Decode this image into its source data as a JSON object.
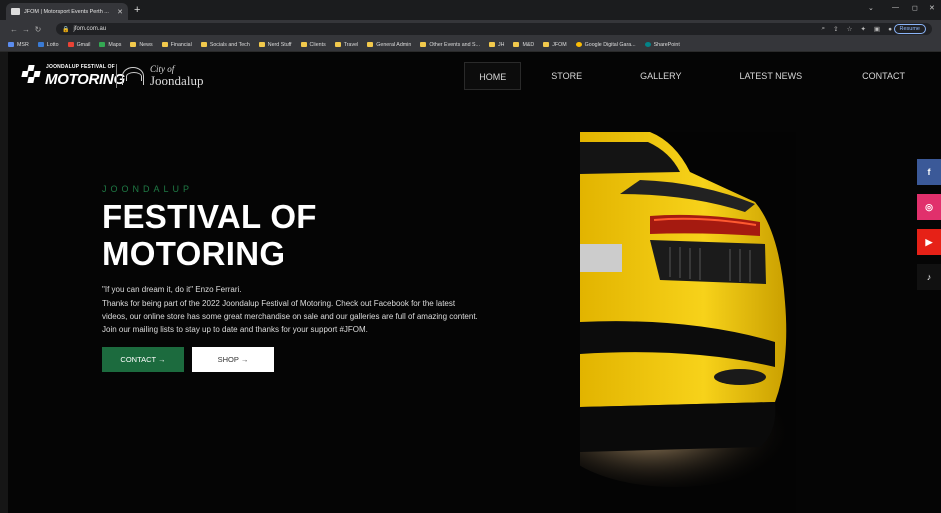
{
  "browser": {
    "tab_title": "JFOM | Motorsport Events Perth ...",
    "tab_close": "✕",
    "new_tab": "+",
    "url": "jfom.com.au",
    "resume_label": "Resume",
    "window_controls": [
      "⌄",
      "—",
      "◻",
      "✕"
    ],
    "bookmarks": [
      "MSR",
      "Lotto",
      "Gmail",
      "Maps",
      "News",
      "Financial",
      "Socials and Tech",
      "Nerd Stuff",
      "Clients",
      "Travel",
      "General Admin",
      "Other Events and S...",
      "JH",
      "M&D",
      "JFOM",
      "Google Digital Gara...",
      "SharePoint"
    ]
  },
  "site": {
    "logo": {
      "festival_small": "JOONDALUP FESTIVAL OF",
      "festival_big": "MOTORING",
      "city_of": "City of",
      "city_name": "Joondalup"
    },
    "nav": [
      "HOME",
      "STORE",
      "GALLERY",
      "LATEST NEWS",
      "CONTACT"
    ],
    "hero": {
      "eyebrow": "JOONDALUP",
      "headline_line1": "FESTIVAL OF",
      "headline_line2": "MOTORING",
      "quote": "\"If you can dream it, do it\" Enzo Ferrari.",
      "body": "Thanks for being part of the 2022 Joondalup Festival of Motoring. Check out Facebook for the latest videos, our online store has some great merchandise on sale and our galleries are full of amazing content. Join our mailing lists to stay up to date and thanks for your support #JFOM.",
      "contact_button": "CONTACT →",
      "shop_button": "SHOP →"
    },
    "social": {
      "facebook": "f",
      "instagram": "◎",
      "youtube": "▶",
      "tiktok": "♪"
    }
  },
  "colors": {
    "accent_green": "#1c6b3e",
    "car_yellow": "#f2c40a",
    "facebook": "#3b5998",
    "instagram": "#e1306c",
    "youtube": "#e62117"
  }
}
